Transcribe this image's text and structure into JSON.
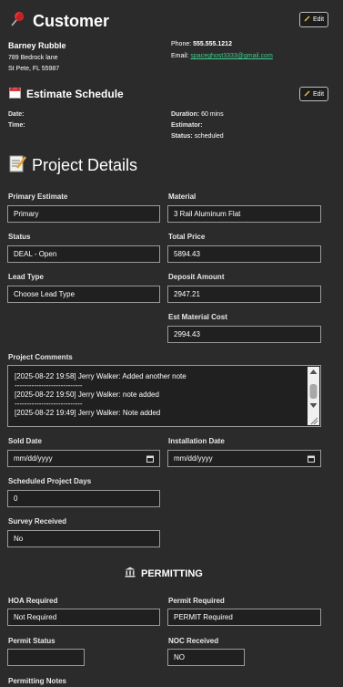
{
  "customer": {
    "title": "Customer",
    "edit_label": "Edit",
    "name": "Barney Rubble",
    "address1": "789 Bedrock lane",
    "address2": "St Pete, FL 55987",
    "phone_label": "Phone:",
    "phone": "555.555.1212",
    "email_label": "Email:",
    "email": "spaceghost3333@gmail.com"
  },
  "schedule": {
    "title": "Estimate Schedule",
    "edit_label": "Edit",
    "date_label": "Date:",
    "time_label": "Time:",
    "duration_label": "Duration:",
    "duration": "60 mins",
    "estimator_label": "Estimator:",
    "status_label": "Status:",
    "status": "scheduled"
  },
  "project": {
    "title": "Project Details",
    "primary_estimate_label": "Primary Estimate",
    "primary_estimate": "Primary",
    "material_label": "Material",
    "material": "3 Rail Aluminum Flat",
    "status_label": "Status",
    "status": "DEAL - Open",
    "total_price_label": "Total Price",
    "total_price": "5894.43",
    "lead_type_label": "Lead Type",
    "lead_type": "Choose Lead Type",
    "deposit_label": "Deposit Amount",
    "deposit": "2947.21",
    "est_material_label": "Est Material Cost",
    "est_material": "2994.43",
    "comments_label": "Project Comments",
    "comments": [
      "[2025-08-22 19:58] Jerry Walker: Added another note",
      "----------------------------",
      "[2025-08-22 19:50] Jerry Walker: note added",
      "----------------------------",
      "[2025-08-22 19:49] Jerry Walker: Note added"
    ],
    "sold_date_label": "Sold Date",
    "sold_date_placeholder": "mm/dd/yyyy",
    "install_date_label": "Installation Date",
    "install_date_placeholder": "mm/dd/yyyy",
    "sched_days_label": "Scheduled Project Days",
    "sched_days": "0",
    "survey_label": "Survey Received",
    "survey": "No"
  },
  "permitting": {
    "title": "PERMITTING",
    "hoa_label": "HOA Required",
    "hoa": "Not Required",
    "permit_req_label": "Permit Required",
    "permit_req": "PERMIT Required",
    "permit_status_label": "Permit Status",
    "permit_status": "",
    "noc_label": "NOC Received",
    "noc": "NO",
    "notes_label": "Permitting Notes"
  },
  "colors": {
    "background": "#2b2b2b",
    "link": "#3fcf8e",
    "pin": "#e0353b"
  }
}
